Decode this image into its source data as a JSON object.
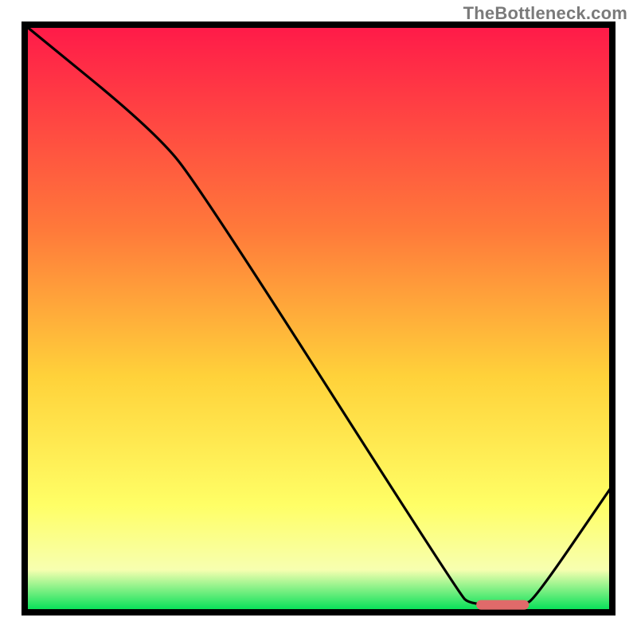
{
  "attribution": "TheBottleneck.com",
  "colors": {
    "gradient_top": "#ff1a49",
    "gradient_mid_upper": "#ff7a3a",
    "gradient_mid": "#ffd23a",
    "gradient_lower": "#ffff66",
    "gradient_pale": "#f7ffb0",
    "gradient_green": "#00e056",
    "axis": "#000000",
    "curve": "#000000",
    "marker_fill": "#e06a6a",
    "marker_stroke": "#c94f4f"
  },
  "chart_data": {
    "type": "line",
    "title": "",
    "xlabel": "",
    "ylabel": "",
    "xlim": [
      0,
      100
    ],
    "ylim": [
      0,
      100
    ],
    "grid": false,
    "legend": false,
    "curve": [
      {
        "x": 0,
        "y": 100
      },
      {
        "x": 22,
        "y": 82
      },
      {
        "x": 30,
        "y": 72
      },
      {
        "x": 74,
        "y": 3
      },
      {
        "x": 76,
        "y": 1
      },
      {
        "x": 85,
        "y": 1
      },
      {
        "x": 87,
        "y": 2
      },
      {
        "x": 100,
        "y": 21
      }
    ],
    "marker": {
      "x_start": 77,
      "x_end": 86,
      "y": 1
    },
    "annotations": []
  }
}
